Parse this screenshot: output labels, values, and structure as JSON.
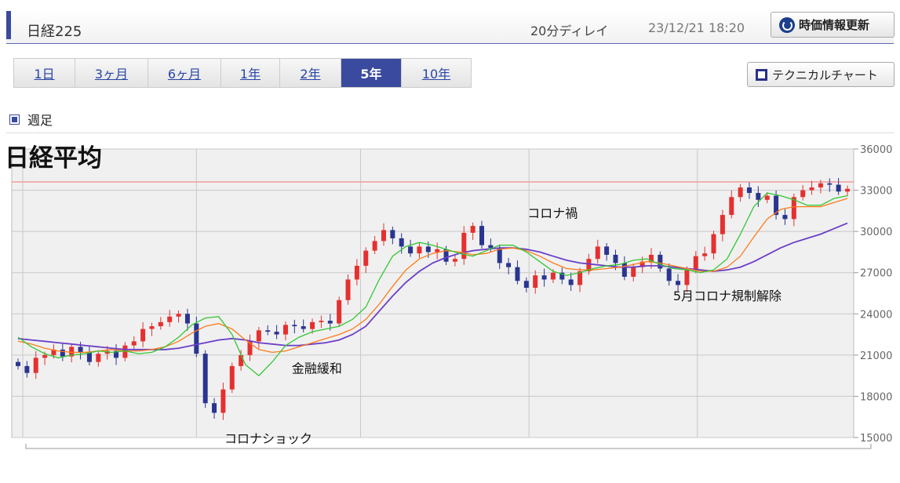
{
  "header": {
    "title": "日経225",
    "delay": "20分ディレイ",
    "timestamp": "23/12/21 18:20",
    "refresh_label": "時価情報更新"
  },
  "tabs": [
    {
      "label": "1日",
      "active": false
    },
    {
      "label": "3ヶ月",
      "active": false
    },
    {
      "label": "6ヶ月",
      "active": false
    },
    {
      "label": "1年",
      "active": false
    },
    {
      "label": "2年",
      "active": false
    },
    {
      "label": "5年",
      "active": true
    },
    {
      "label": "10年",
      "active": false
    }
  ],
  "technical_chart_label": "テクニカルチャート",
  "section_label": "週足",
  "colors": {
    "accent": "#3a4a9e",
    "up": "#e53030",
    "down": "#2a3590",
    "ma_short": "#33c733",
    "ma_mid": "#ff7a1a",
    "ma_long": "#6a3fc7",
    "current_line": "#f29a9a"
  },
  "chart_data": {
    "type": "candlestick",
    "title": "日経平均",
    "ylim": [
      15000,
      36000
    ],
    "yticks": [
      15000,
      18000,
      21000,
      24000,
      27000,
      30000,
      33000,
      36000
    ],
    "grid": true,
    "reference_line": 33600,
    "x_range": [
      "2018-12",
      "2023-12"
    ],
    "ma_short": [
      22300,
      21600,
      21100,
      20800,
      21000,
      21100,
      21300,
      21200,
      21300,
      21100,
      21200,
      21600,
      22300,
      23200,
      23700,
      23800,
      22500,
      20300,
      19500,
      20500,
      21700,
      22300,
      22700,
      22900,
      23100,
      23600,
      24500,
      26500,
      28200,
      28900,
      29200,
      29000,
      28700,
      28400,
      28200,
      28600,
      29000,
      29000,
      28500,
      27800,
      27100,
      26800,
      27000,
      27300,
      27500,
      27600,
      27900,
      28000,
      27600,
      27300,
      27200,
      27000,
      27200,
      28000,
      29800,
      31800,
      32800,
      32600,
      32300,
      31900,
      31900,
      32400,
      32600
    ],
    "ma_mid": [
      22000,
      21800,
      21500,
      21300,
      21200,
      21200,
      21300,
      21400,
      21300,
      21300,
      21400,
      21600,
      22000,
      22600,
      23100,
      23300,
      22900,
      22100,
      21400,
      21200,
      21300,
      21600,
      21900,
      22200,
      22500,
      22900,
      23600,
      24700,
      26000,
      27200,
      28000,
      28400,
      28600,
      28500,
      28300,
      28400,
      28700,
      28800,
      28600,
      28200,
      27700,
      27300,
      27200,
      27200,
      27300,
      27400,
      27600,
      27800,
      27700,
      27500,
      27300,
      27100,
      27100,
      27400,
      28200,
      29600,
      30900,
      31600,
      31800,
      31800,
      31800,
      32100,
      32400
    ],
    "ma_long": [
      22200,
      22100,
      22000,
      21900,
      21800,
      21700,
      21600,
      21500,
      21400,
      21400,
      21400,
      21400,
      21500,
      21700,
      21900,
      22100,
      22200,
      22100,
      21900,
      21800,
      21700,
      21700,
      21800,
      21900,
      22100,
      22500,
      23100,
      24200,
      25300,
      26300,
      27100,
      27700,
      28100,
      28400,
      28600,
      28700,
      28800,
      28800,
      28700,
      28500,
      28200,
      27900,
      27700,
      27600,
      27500,
      27400,
      27400,
      27500,
      27500,
      27400,
      27300,
      27200,
      27100,
      27200,
      27400,
      27800,
      28300,
      28800,
      29200,
      29500,
      29800,
      30200,
      30600
    ],
    "annotations": [
      {
        "text": "コロナショック",
        "x_frac": 0.26,
        "value": 14600
      },
      {
        "text": "金融緩和",
        "x_frac": 0.34,
        "value": 19700
      },
      {
        "text": "コロナ禍",
        "x_frac": 0.62,
        "value": 31000
      },
      {
        "text": "5月コロナ規制解除",
        "x_frac": 0.793,
        "value": 25000
      }
    ],
    "closes": [
      20200,
      19700,
      20800,
      21000,
      21400,
      20900,
      21600,
      21200,
      20500,
      21100,
      21300,
      20800,
      21700,
      22000,
      22900,
      23100,
      23400,
      23800,
      24000,
      23300,
      21100,
      17500,
      16800,
      18500,
      20200,
      21000,
      22000,
      22800,
      22700,
      22500,
      23200,
      23100,
      22900,
      23400,
      23500,
      23300,
      25000,
      26500,
      27500,
      28600,
      29300,
      30100,
      29500,
      28900,
      28400,
      28900,
      28500,
      28700,
      27800,
      28000,
      29900,
      30400,
      29000,
      28800,
      27700,
      27400,
      26400,
      25900,
      26800,
      26500,
      27000,
      26500,
      26100,
      27100,
      28000,
      28900,
      28300,
      27700,
      26700,
      27400,
      27800,
      28300,
      27300,
      26400,
      26100,
      27200,
      28200,
      28400,
      29800,
      31200,
      32500,
      33200,
      32800,
      32300,
      32600,
      31200,
      30900,
      32500,
      33000,
      33200,
      33500,
      33400,
      32900,
      33100
    ]
  }
}
